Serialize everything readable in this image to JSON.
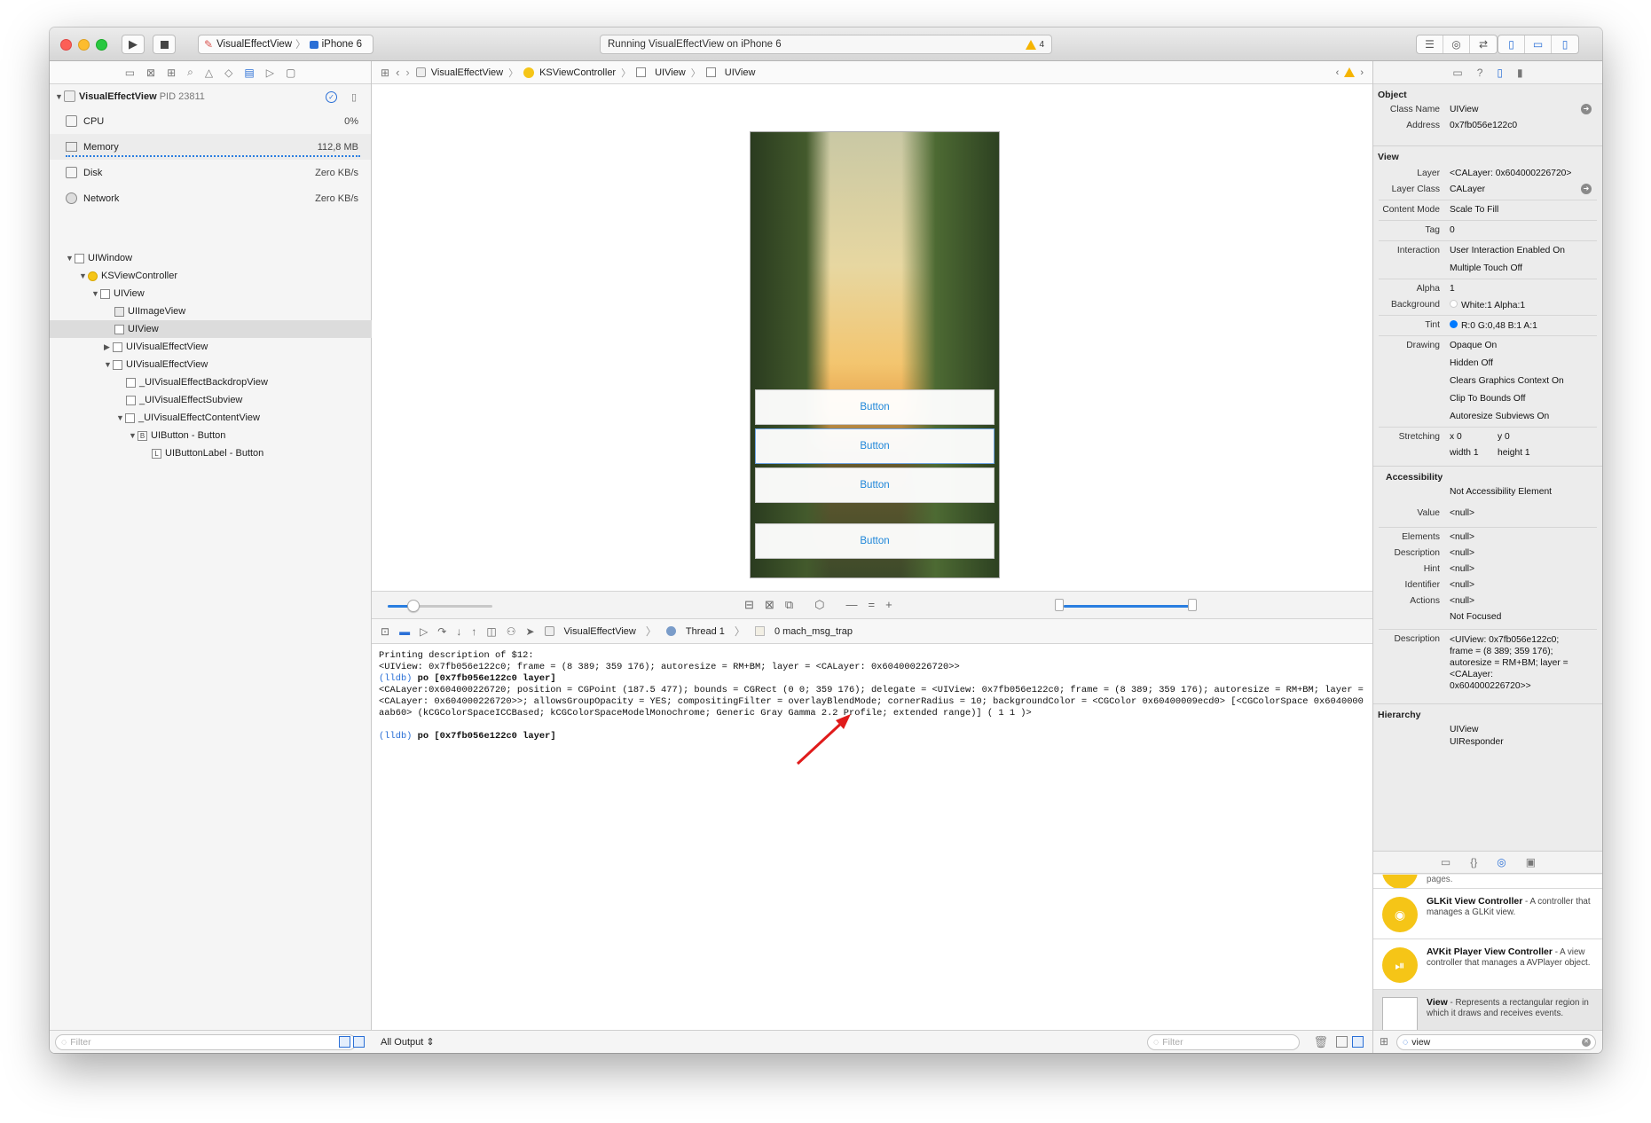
{
  "toolbar": {
    "scheme": "VisualEffectView",
    "device": "iPhone 6",
    "status": "Running VisualEffectView on iPhone 6",
    "warnings": "4"
  },
  "colors": {
    "accent": "#2a6fd6",
    "warning": "#f5b400",
    "button_text": "#1e86d9",
    "red_arrow": "#e01b1b"
  },
  "navigator": {
    "process": "VisualEffectView",
    "pid": "PID 23811",
    "gauges": [
      {
        "label": "CPU",
        "value": "0%"
      },
      {
        "label": "Memory",
        "value": "112,8 MB"
      },
      {
        "label": "Disk",
        "value": "Zero KB/s"
      },
      {
        "label": "Network",
        "value": "Zero KB/s"
      }
    ],
    "tree": [
      {
        "label": "UIWindow"
      },
      {
        "label": "KSViewController"
      },
      {
        "label": "UIView"
      },
      {
        "label": "UIImageView"
      },
      {
        "label": "UIView"
      },
      {
        "label": "UIVisualEffectView"
      },
      {
        "label": "UIVisualEffectView"
      },
      {
        "label": "_UIVisualEffectBackdropView"
      },
      {
        "label": "_UIVisualEffectSubview"
      },
      {
        "label": "_UIVisualEffectContentView"
      },
      {
        "label": "UIButton - Button"
      },
      {
        "label": "UIButtonLabel - Button"
      }
    ],
    "filter_placeholder": "Filter"
  },
  "jumpbar": [
    "VisualEffectView",
    "KSViewController",
    "UIView",
    "UIView"
  ],
  "canvas": {
    "buttons": [
      "Button",
      "Button",
      "Button",
      "Button"
    ]
  },
  "debugbar": {
    "target": "VisualEffectView",
    "thread": "Thread 1",
    "frame": "0 mach_msg_trap"
  },
  "console": {
    "line1": "Printing description of $12:",
    "line2": "<UIView: 0x7fb056e122c0; frame = (8 389; 359 176); autoresize = RM+BM; layer = <CALayer: 0x604000226720>>",
    "prompt": "(lldb)",
    "cmd1": "po [0x7fb056e122c0 layer]",
    "output": "<CALayer:0x604000226720; position = CGPoint (187.5 477); bounds = CGRect (0 0; 359 176); delegate = <UIView: 0x7fb056e122c0; frame = (8 389; 359 176); autoresize = RM+BM; layer = <CALayer: 0x604000226720>>; allowsGroupOpacity = YES; compositingFilter = overlayBlendMode; cornerRadius = 10; backgroundColor = <CGColor 0x60400009ecd0> [<CGColorSpace 0x6040000aab60> (kCGColorSpaceICCBased; kCGColorSpaceModelMonochrome; Generic Gray Gamma 2.2 Profile; extended range)] ( 1 1 )>",
    "cmd2": "po [0x7fb056e122c0 layer]",
    "output_filter": "All Output",
    "filter_placeholder": "Filter"
  },
  "inspector": {
    "object_header": "Object",
    "class_name_key": "Class Name",
    "class_name": "UIView",
    "address_key": "Address",
    "address": "0x7fb056e122c0",
    "view_header": "View",
    "layer_key": "Layer",
    "layer": "<CALayer: 0x604000226720>",
    "layer_class_key": "Layer Class",
    "layer_class": "CALayer",
    "content_mode_key": "Content Mode",
    "content_mode": "Scale To Fill",
    "tag_key": "Tag",
    "tag": "0",
    "interaction_key": "Interaction",
    "interaction1": "User Interaction Enabled On",
    "interaction2": "Multiple Touch Off",
    "alpha_key": "Alpha",
    "alpha": "1",
    "background_key": "Background",
    "background": "White:1 Alpha:1",
    "tint_key": "Tint",
    "tint": "R:0 G:0,48 B:1 A:1",
    "drawing_key": "Drawing",
    "drawing": [
      "Opaque On",
      "Hidden Off",
      "Clears Graphics Context On",
      "Clip To Bounds Off",
      "Autoresize Subviews On"
    ],
    "stretching_key": "Stretching",
    "sx": "x 0",
    "sy": "y 0",
    "sw": "width 1",
    "sh": "height 1",
    "access_header": "Accessibility",
    "not_element": "Not Accessibility Element",
    "value_key": "Value",
    "value": "<null>",
    "elements_key": "Elements",
    "elements": "<null>",
    "description_key": "Description",
    "description_acc": "<null>",
    "hint_key": "Hint",
    "hint": "<null>",
    "identifier_key": "Identifier",
    "identifier": "<null>",
    "actions_key": "Actions",
    "actions": "<null>",
    "not_focused": "Not Focused",
    "desc_key": "Description",
    "desc_lines": [
      "<UIView: 0x7fb056e122c0;",
      "frame = (8 389; 359 176);",
      "autoresize = RM+BM; layer =",
      "<CALayer:",
      "0x604000226720>>"
    ],
    "hierarchy_header": "Hierarchy",
    "hierarchy": [
      "UIView",
      "UIResponder"
    ]
  },
  "library": {
    "partial": "pages.",
    "items": [
      {
        "title": "GLKit View Controller",
        "desc": " - A controller that manages a GLKit view."
      },
      {
        "title": "AVKit Player View Controller",
        "desc": " - A view controller that manages a AVPlayer object."
      },
      {
        "title": "View",
        "desc": " - Represents a rectangular region in which it draws and receives events."
      }
    ],
    "search": "view"
  }
}
